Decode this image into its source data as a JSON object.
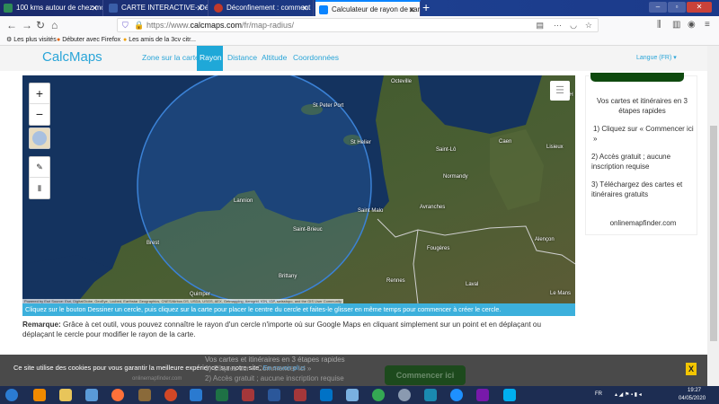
{
  "browser": {
    "tabs": [
      {
        "title": "100 kms autour de chez moi ...",
        "color": "#2e8b57"
      },
      {
        "title": "CARTE INTERACTIVE- Déconfin",
        "color": "#3a5ea8"
      },
      {
        "title": "Déconfinement : comment calc",
        "color": "#c0392b"
      },
      {
        "title": "Calculateur de rayon de carte",
        "color": "#0a84ff"
      }
    ],
    "new_tab": "+",
    "url_prefix": "https://www.",
    "url_domain": "calcmaps.com",
    "url_path": "/fr/map-radius/",
    "bookmarks": [
      "Les plus visités",
      "Débuter avec Firefox",
      "Les amis de la 3cv citr..."
    ]
  },
  "site": {
    "logo": "CalcMaps",
    "nav": [
      "Zone sur la carte",
      "Rayon",
      "Distance",
      "Altitude",
      "Coordonnées"
    ],
    "active_nav": "Rayon",
    "language": "Langue (FR) ▾",
    "accent": "#1fa8d8"
  },
  "map": {
    "zoom_in": "+",
    "zoom_out": "−",
    "cities": [
      "St Peter Port",
      "St Helier",
      "Lannion",
      "Saint Malo",
      "Saint-Brieuc",
      "Brest",
      "Brittany",
      "Quimper",
      "Octeville",
      "Saint-Lô",
      "Caen",
      "Lisieux",
      "Le H",
      "Normandy",
      "Avranches",
      "Fougères",
      "Alençon",
      "Rennes",
      "Laval",
      "Le Mans"
    ],
    "attribution": "Powered by Esri Source: Esri, DigitalGlobe, GeoEye, i-cubed, Earthstar Geographics, CNES/Airbus DS, USDA, USGS, AEX, Getmapping, Aerogrid, IGN, IGP, swisstopo, and the GIS User Community",
    "circle_color": "#3b82d6"
  },
  "hint": "Cliquez sur le bouton Dessiner un cercle, puis cliquez sur la carte pour placer le centre du cercle et faites-le glisser en même temps pour commencer à créer le cercle.",
  "remark": {
    "label": "Remarque:",
    "text": " Grâce à cet outil, vous pouvez connaître le rayon d'un cercle n'importe où sur Google Maps en cliquant simplement sur un point et en déplaçant ou déplaçant le cercle pour modifier le rayon de la carte."
  },
  "ad": {
    "title": "Vos cartes et itinéraires en 3 étapes rapides",
    "steps": [
      "1) Cliquez sur « Commencer ici »",
      "2) Accès gratuit ; aucune inscription requise",
      "3) Téléchargez des cartes et itinéraires gratuits"
    ],
    "domain": "onlinemapfinder.com"
  },
  "cookie": {
    "text": "Ce site utilise des cookies pour vous garantir la meilleure expérience sur notre site.",
    "link": "En savoir plus",
    "close": "X"
  },
  "ad_bottom": {
    "line1": "Vos cartes et itinéraires en 3 étapes rapides",
    "line2": "1) Cliquez sur « Commencer ici »",
    "line3": "2) Accès gratuit ; aucune inscription requise",
    "domain": "onlinemapfinder.com",
    "button": "Commencer ici"
  },
  "taskbar": {
    "lang": "FR",
    "time": "19:27",
    "date": "04/05/2020"
  }
}
